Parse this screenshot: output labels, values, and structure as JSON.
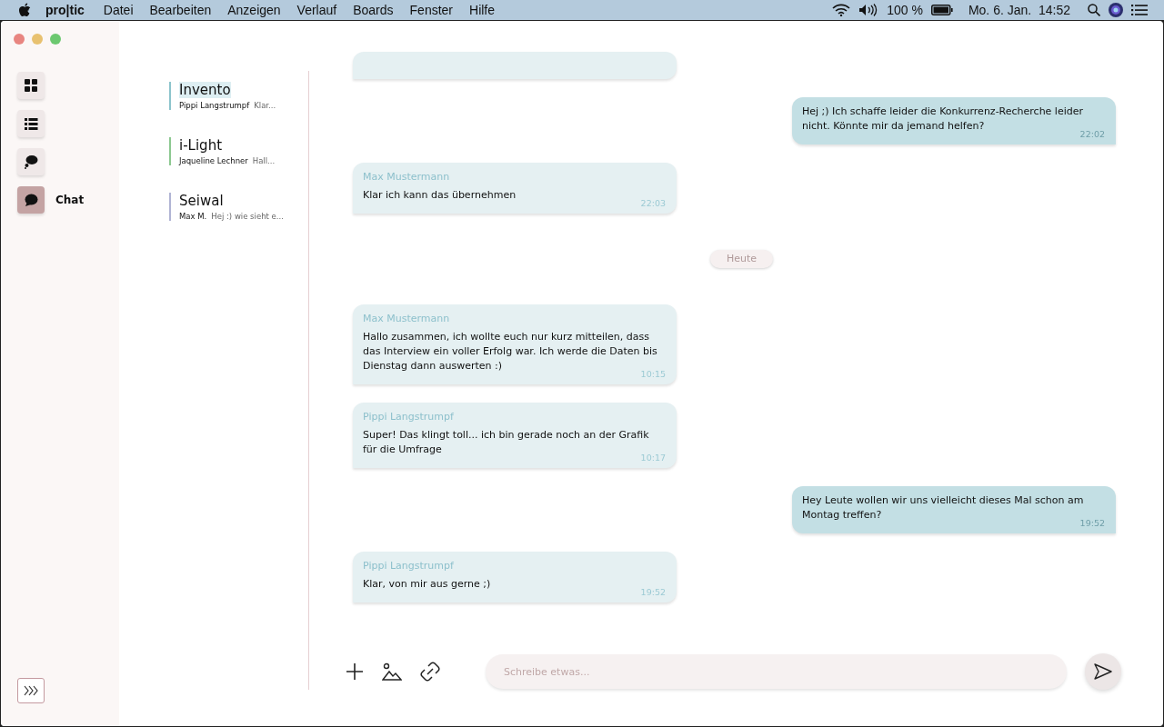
{
  "menu_bar": {
    "app": "pro|tic",
    "items": [
      "Datei",
      "Bearbeiten",
      "Anzeigen",
      "Verlauf",
      "Boards",
      "Fenster",
      "Hilfe"
    ],
    "battery": "100 %",
    "clock": "Mo. 6. Jan.  14:52"
  },
  "sidebar": {
    "items": [
      {
        "selected": false
      },
      {
        "selected": false
      },
      {
        "selected": false
      },
      {
        "label": "Chat",
        "selected": true
      }
    ]
  },
  "conversations": [
    {
      "title": "Invento",
      "sender": "Pippi Langstrumpf",
      "preview": "Klar...",
      "color": "#8cc4cc",
      "selected": true
    },
    {
      "title": "i-Light",
      "sender": "Jaqueline Lechner",
      "preview": "Hall...",
      "color": "#8cc890",
      "selected": false
    },
    {
      "title": "Seiwal",
      "sender": "Max M.",
      "preview": "Hej :) wie sieht e...",
      "color": "#b0b4d4",
      "selected": false
    }
  ],
  "messages": [
    {
      "kind": "partial"
    },
    {
      "kind": "outgoing",
      "text": "Hej ;) Ich schaffe leider die Konkurrenz-Recherche leider nicht. Könnte mir da jemand helfen?",
      "time": "22:02"
    },
    {
      "kind": "incoming",
      "author": "Max Mustermann",
      "text": "Klar ich kann das übernehmen",
      "time": "22:03"
    },
    {
      "kind": "date",
      "text": "Heute"
    },
    {
      "kind": "incoming",
      "author": "Max Mustermann",
      "text": "Hallo zusammen, ich wollte euch nur kurz mitteilen, dass das Interview ein voller Erfolg war. Ich werde die Daten bis Dienstag dann auswerten :)",
      "time": "10:15"
    },
    {
      "kind": "incoming",
      "author": "Pippi Langstrumpf",
      "text": "Super! Das klingt toll... ich bin gerade noch an der Grafik für die Umfrage",
      "time": "10:17"
    },
    {
      "kind": "outgoing",
      "text": "Hey Leute wollen wir uns vielleicht dieses Mal schon am Montag treffen?",
      "time": "19:52"
    },
    {
      "kind": "incoming",
      "author": "Pippi Langstrumpf",
      "text": "Klar, von mir aus gerne ;)",
      "time": "19:52"
    }
  ],
  "composer": {
    "placeholder": "Schreibe etwas..."
  }
}
